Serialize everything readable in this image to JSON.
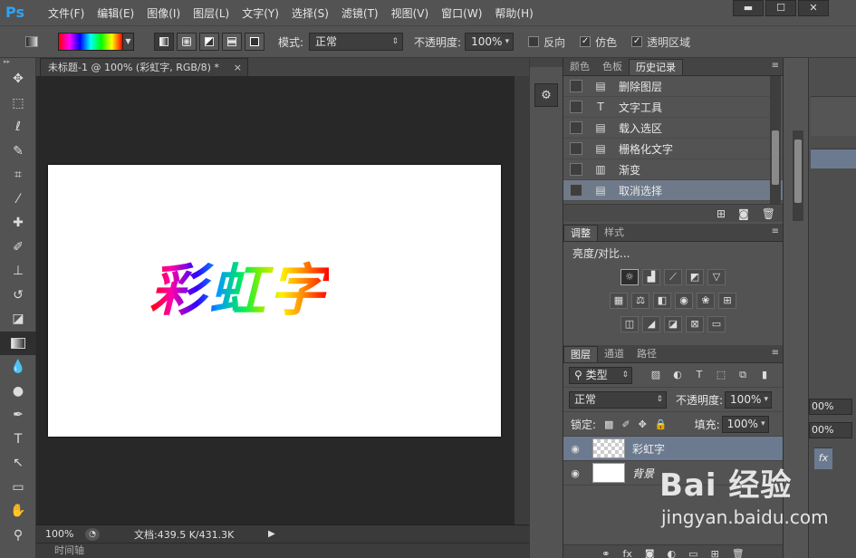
{
  "app": {
    "logo": "Ps"
  },
  "menu": [
    "文件(F)",
    "编辑(E)",
    "图像(I)",
    "图层(L)",
    "文字(Y)",
    "选择(S)",
    "滤镜(T)",
    "视图(V)",
    "窗口(W)",
    "帮助(H)"
  ],
  "window_controls": {
    "minimize": "▬",
    "maximize": "☐",
    "close": "✕"
  },
  "options": {
    "mode_label": "模式:",
    "mode_value": "正常",
    "opacity_label": "不透明度:",
    "opacity_value": "100%",
    "reverse_label": "反向",
    "dither_label": "仿色",
    "transparency_label": "透明区域",
    "reverse_checked": false,
    "dither_checked": true,
    "transparency_checked": true
  },
  "document": {
    "tab_title": "未标题-1 @ 100% (彩虹字, RGB/8) *",
    "tab_close": "×",
    "canvas_text": "彩虹字",
    "zoom": "100%",
    "doc_info": "文档:439.5 K/431.3K"
  },
  "timeline": {
    "label": "时间轴"
  },
  "history_panel": {
    "tabs": [
      "颜色",
      "色板",
      "历史记录"
    ],
    "active_tab": "历史记录",
    "items": [
      {
        "label": "删除图层",
        "icon": "doc-icon"
      },
      {
        "label": "文字工具",
        "icon": "type-icon"
      },
      {
        "label": "载入选区",
        "icon": "doc-icon"
      },
      {
        "label": "栅格化文字",
        "icon": "doc-icon"
      },
      {
        "label": "渐变",
        "icon": "gradient-icon"
      },
      {
        "label": "取消选择",
        "icon": "doc-icon"
      }
    ],
    "selected_index": 5
  },
  "adjustments_panel": {
    "tabs": [
      "调整",
      "样式"
    ],
    "active_tab": "调整",
    "title": "亮度/对比..."
  },
  "layers_panel": {
    "tabs": [
      "图层",
      "通道",
      "路径"
    ],
    "active_tab": "图层",
    "filter_label": "类型",
    "blend_mode": "正常",
    "opacity_label": "不透明度:",
    "opacity_value": "100%",
    "lock_label": "锁定:",
    "fill_label": "填充:",
    "fill_value": "100%",
    "layers": [
      {
        "name": "彩虹字",
        "selected": true,
        "thumb": "transparent"
      },
      {
        "name": "背景",
        "selected": false,
        "thumb": "white"
      }
    ]
  },
  "right_dock": {
    "opacity_a": "00%",
    "opacity_b": "00%",
    "fx": "fx"
  },
  "watermark": {
    "logo": "Bai 经验",
    "url": "jingyan.baidu.com"
  },
  "colors": {
    "panel_bg": "#535353",
    "canvas_area": "#282828",
    "selection": "#6b7a8f",
    "ps_blue": "#2fa3f5"
  }
}
